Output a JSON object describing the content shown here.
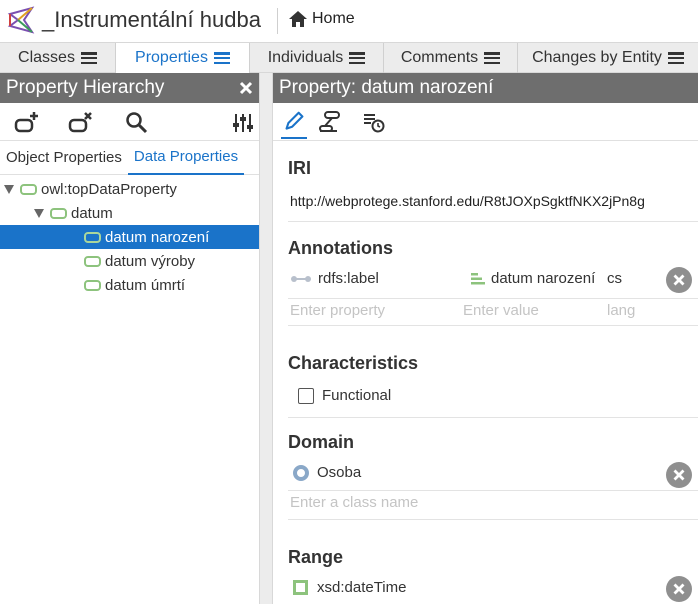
{
  "app": {
    "project_title": "_Instrumentální hudba",
    "home_label": "Home"
  },
  "tabs": [
    {
      "label": "Classes",
      "active": false
    },
    {
      "label": "Properties",
      "active": true
    },
    {
      "label": "Individuals",
      "active": false
    },
    {
      "label": "Comments",
      "active": false
    },
    {
      "label": "Changes by Entity",
      "active": false
    }
  ],
  "left_panel": {
    "title": "Property Hierarchy",
    "subtabs": [
      {
        "label": "Object Properties",
        "active": false
      },
      {
        "label": "Data Properties",
        "active": true
      }
    ],
    "tree": [
      {
        "label": "owl:topDataProperty",
        "expanded": true,
        "selected": false
      },
      {
        "label": "datum",
        "expanded": true,
        "selected": false
      },
      {
        "label": "datum narození",
        "expanded": false,
        "selected": true
      },
      {
        "label": "datum výroby",
        "expanded": false,
        "selected": false
      },
      {
        "label": "datum úmrtí",
        "expanded": false,
        "selected": false
      }
    ]
  },
  "right_panel": {
    "title": "Property: datum narození",
    "iri_heading": "IRI",
    "iri_value": "http://webprotege.stanford.edu/R8tJOXpSgktfNKX2jPn8g",
    "annotations_heading": "Annotations",
    "annotation": {
      "property": "rdfs:label",
      "value": "datum narození",
      "lang": "cs"
    },
    "annotation_placeholders": {
      "property": "Enter property",
      "value": "Enter value",
      "lang": "lang"
    },
    "characteristics_heading": "Characteristics",
    "functional_label": "Functional",
    "functional_checked": false,
    "domain_heading": "Domain",
    "domain_value": "Osoba",
    "domain_placeholder": "Enter a class name",
    "range_heading": "Range",
    "range_value": "xsd:dateTime"
  },
  "colors": {
    "accent": "#1a73c9",
    "panel_header": "#6e6e6e",
    "data_property_icon": "#8dc37d",
    "delete_button": "#8f8f8f"
  },
  "icons": {
    "logo": "webprotege-logo",
    "home": "home-icon",
    "close": "close-icon",
    "add": "add-property-icon",
    "remove": "remove-property-icon",
    "search": "search-icon",
    "settings": "sliders-icon",
    "edit": "pencil-icon",
    "usage": "usage-icon",
    "history": "history-icon"
  }
}
